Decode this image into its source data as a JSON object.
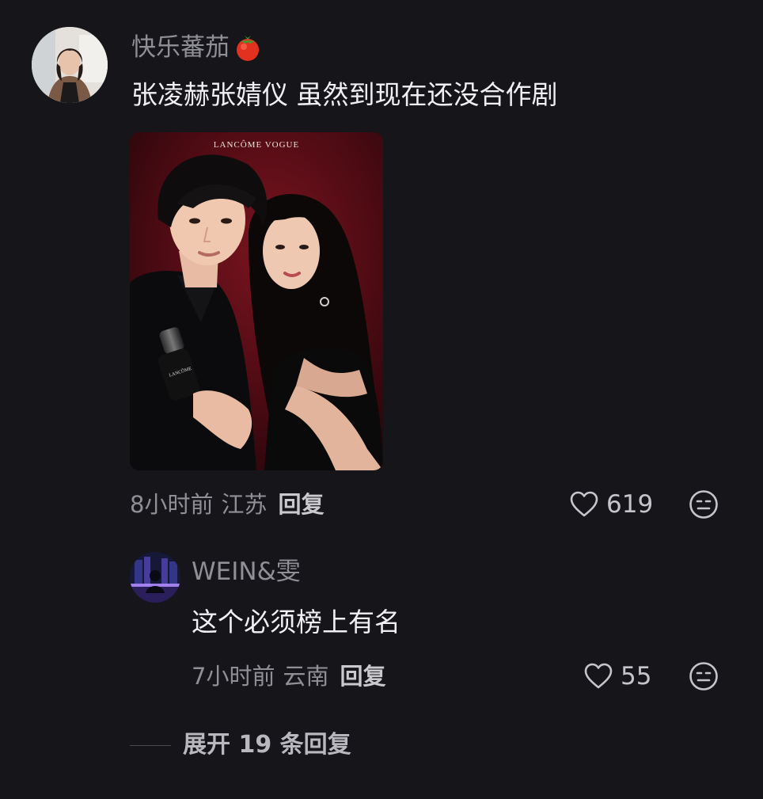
{
  "comment": {
    "username": "快乐蕃茄",
    "username_emoji": "tomato-emoji",
    "text": "张凌赫张婧仪 虽然到现在还没合作剧",
    "image": {
      "caption": "LANCÔME VOGUE"
    },
    "time": "8小时前",
    "location": "江苏",
    "reply_label": "回复",
    "likes": "619"
  },
  "reply": {
    "username": "WEIN&雯",
    "text": "这个必须榜上有名",
    "time": "7小时前",
    "location": "云南",
    "reply_label": "回复",
    "likes": "55"
  },
  "expand": {
    "label": "展开 19 条回复"
  },
  "colors": {
    "background": "#16161a",
    "muted_text": "#8f8f96",
    "primary_text": "#f0f0f2"
  }
}
